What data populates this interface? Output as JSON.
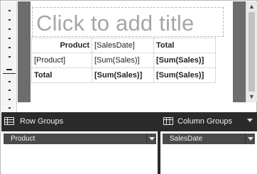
{
  "report": {
    "title_placeholder": "Click to add title",
    "tablix": {
      "rows": [
        [
          "Product",
          "[SalesDate]",
          "Total"
        ],
        [
          "[Product]",
          "[Sum(Sales)]",
          "[Sum(Sales)]"
        ],
        [
          "Total",
          "[Sum(Sales)]",
          "[Sum(Sales)]"
        ]
      ]
    }
  },
  "groups": {
    "row_groups_label": "Row Groups",
    "column_groups_label": "Column Groups",
    "row_groups": [
      "Product"
    ],
    "column_groups": [
      "SalesDate"
    ]
  },
  "icons": {
    "grid": "grid-icon",
    "scroll_up": "scroll-up-icon",
    "scroll_down": "scroll-down-icon",
    "dropdown": "chevron-down-icon"
  },
  "colors": {
    "groups_background": "#2b2b2b",
    "group_item": "#4a4a4a",
    "design_background": "#6d6d6d"
  }
}
